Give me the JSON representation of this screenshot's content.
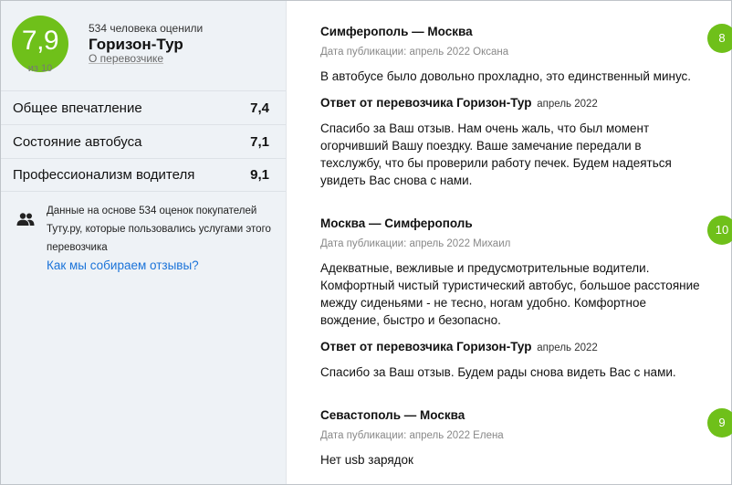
{
  "summary": {
    "score": "7,9",
    "scale": "из 10",
    "raters": "534 человека оценили",
    "company": "Горизон-Тур",
    "about_link": "О перевозчике",
    "score_color": "#6fc01a"
  },
  "metrics": [
    {
      "label": "Общее впечатление",
      "value": "7,4"
    },
    {
      "label": "Состояние автобуса",
      "value": "7,1"
    },
    {
      "label": "Профессионализм водителя",
      "value": "9,1"
    }
  ],
  "note": {
    "icon": "people-icon",
    "text": "Данные на основе 534 оценок покупателей Туту.ру, которые пользовались услугами этого перевозчика",
    "link": "Как мы собираем отзывы?"
  },
  "reviews": [
    {
      "route": "Симферополь — Москва",
      "meta": "Дата публикации: апрель 2022 Оксана",
      "rating": "8",
      "text": "В автобусе было довольно прохладно, это единственный минус.",
      "reply_title": "Ответ от перевозчика Горизон-Тур",
      "reply_date": "апрель 2022",
      "reply_text": "Спасибо за Ваш отзыв. Нам очень жаль, что был момент огорчивший Вашу поездку. Ваше замечание передали в техслужбу, что бы проверили работу печек. Будем надеяться увидеть Вас снова с нами."
    },
    {
      "route": "Москва — Симферополь",
      "meta": "Дата публикации: апрель 2022 Михаил",
      "rating": "10",
      "text": "Адекватные, вежливые и предусмотрительные водители. Комфортный чистый туристический автобус, большое расстояние между сиденьями - не тесно, ногам удобно. Комфортное вождение, быстро и безопасно.",
      "reply_title": "Ответ от перевозчика Горизон-Тур",
      "reply_date": "апрель 2022",
      "reply_text": "Спасибо за Ваш отзыв. Будем рады снова видеть Вас с нами."
    },
    {
      "route": "Севастополь — Москва",
      "meta": "Дата публикации: апрель 2022 Елена",
      "rating": "9",
      "text": "Нет usb зарядок"
    }
  ]
}
